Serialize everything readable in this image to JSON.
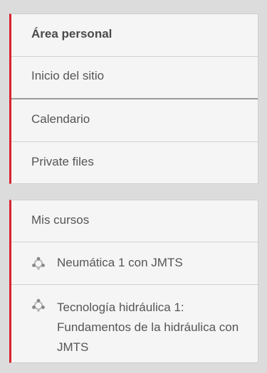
{
  "navigation": {
    "items": [
      {
        "label": "Área personal"
      },
      {
        "label": "Inicio del sitio"
      },
      {
        "label": "Calendario"
      },
      {
        "label": "Private files"
      }
    ]
  },
  "courses": {
    "header": "Mis cursos",
    "items": [
      {
        "label": "Neumática 1 con JMTS",
        "icon": "course-icon"
      },
      {
        "label": "Tecnología hidráulica 1: Fundamentos de la hidráulica con JMTS",
        "icon": "course-icon"
      }
    ]
  },
  "colors": {
    "accent": "#d8232f",
    "background": "#dcdcdc",
    "panel": "#f5f5f5",
    "text": "#555555"
  }
}
